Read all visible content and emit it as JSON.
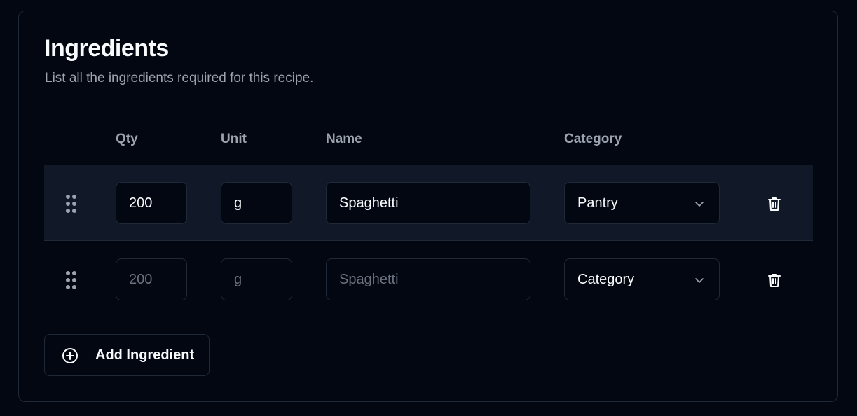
{
  "section": {
    "title": "Ingredients",
    "subtitle": "List all the ingredients required for this recipe."
  },
  "columns": {
    "qty": "Qty",
    "unit": "Unit",
    "name": "Name",
    "category": "Category"
  },
  "rows": [
    {
      "qty": "200",
      "unit": "g",
      "name": "Spaghetti",
      "category": "Pantry",
      "filled": true
    },
    {
      "qty": "200",
      "unit": "g",
      "name": "Spaghetti",
      "category": "Category",
      "filled": false
    }
  ],
  "add_button": {
    "label": "Add Ingredient"
  },
  "icons": {
    "drag": "grip-vertical-icon",
    "delete": "trash-icon",
    "dropdown": "chevron-down-icon",
    "add": "plus-circle-icon"
  },
  "colors": {
    "background": "#030712",
    "row_highlight": "#111827",
    "border": "#1f2937",
    "muted_text": "#9ca3af",
    "placeholder_text": "#6b7280",
    "text": "#f9fafb"
  }
}
